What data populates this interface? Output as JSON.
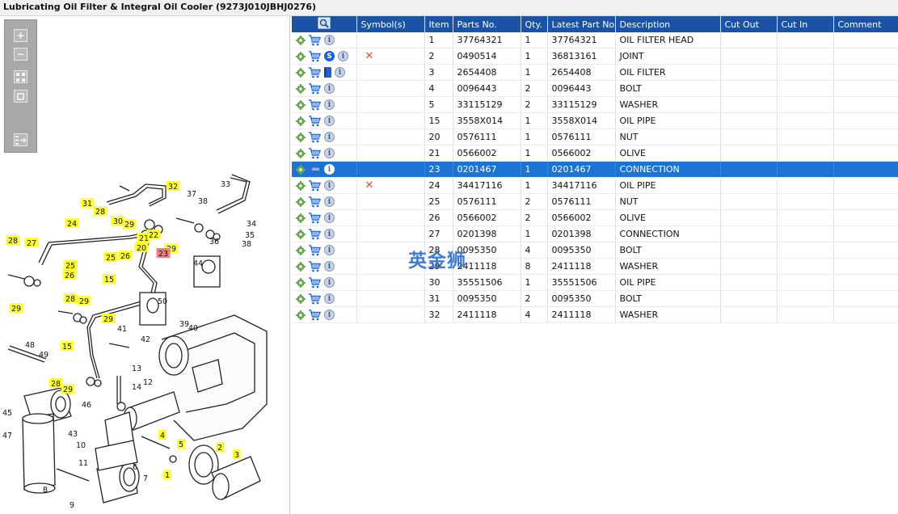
{
  "window": {
    "title": "Lubricating Oil Filter & Integral Oil Cooler (9273J010JBHJ0276)"
  },
  "watermark": "英金狮",
  "toolbar": {
    "zoom_in": "+",
    "zoom_out": "−"
  },
  "colors": {
    "header_bg": "#1a52a5",
    "selected_row": "#1b74d4",
    "callout_yellow": "#ffff33",
    "callout_highlight": "#f08080",
    "remove_mark": "#e2501e"
  },
  "columns": [
    "Symbol(s)",
    "Item",
    "Parts No.",
    "Qty.",
    "Latest Part No.",
    "Description",
    "Cut Out",
    "Cut In",
    "Comment"
  ],
  "rows": [
    {
      "item": "1",
      "part": "37764321",
      "qty": "1",
      "latest": "37764321",
      "desc": "OIL FILTER HEAD",
      "badge": "",
      "mark": ""
    },
    {
      "item": "2",
      "part": "0490514",
      "qty": "1",
      "latest": "36813161",
      "desc": "JOINT",
      "badge": "S",
      "mark": "✕"
    },
    {
      "item": "3",
      "part": "2654408",
      "qty": "1",
      "latest": "2654408",
      "desc": "OIL FILTER",
      "badge": "book",
      "mark": ""
    },
    {
      "item": "4",
      "part": "0096443",
      "qty": "2",
      "latest": "0096443",
      "desc": "BOLT",
      "badge": "",
      "mark": ""
    },
    {
      "item": "5",
      "part": "33115129",
      "qty": "2",
      "latest": "33115129",
      "desc": "WASHER",
      "badge": "",
      "mark": ""
    },
    {
      "item": "15",
      "part": "3558X014",
      "qty": "1",
      "latest": "3558X014",
      "desc": "OIL PIPE",
      "badge": "",
      "mark": ""
    },
    {
      "item": "20",
      "part": "0576111",
      "qty": "1",
      "latest": "0576111",
      "desc": "NUT",
      "badge": "",
      "mark": ""
    },
    {
      "item": "21",
      "part": "0566002",
      "qty": "1",
      "latest": "0566002",
      "desc": "OLIVE",
      "badge": "",
      "mark": ""
    },
    {
      "item": "23",
      "part": "0201467",
      "qty": "1",
      "latest": "0201467",
      "desc": "CONNECTION",
      "badge": "",
      "mark": "",
      "selected": true
    },
    {
      "item": "24",
      "part": "34417116",
      "qty": "1",
      "latest": "34417116",
      "desc": "OIL PIPE",
      "badge": "",
      "mark": "✕"
    },
    {
      "item": "25",
      "part": "0576111",
      "qty": "2",
      "latest": "0576111",
      "desc": "NUT",
      "badge": "",
      "mark": ""
    },
    {
      "item": "26",
      "part": "0566002",
      "qty": "2",
      "latest": "0566002",
      "desc": "OLIVE",
      "badge": "",
      "mark": ""
    },
    {
      "item": "27",
      "part": "0201398",
      "qty": "1",
      "latest": "0201398",
      "desc": "CONNECTION",
      "badge": "",
      "mark": ""
    },
    {
      "item": "28",
      "part": "0095350",
      "qty": "4",
      "latest": "0095350",
      "desc": "BOLT",
      "badge": "",
      "mark": ""
    },
    {
      "item": "29",
      "part": "2411118",
      "qty": "8",
      "latest": "2411118",
      "desc": "WASHER",
      "badge": "",
      "mark": ""
    },
    {
      "item": "30",
      "part": "35551506",
      "qty": "1",
      "latest": "35551506",
      "desc": "OIL PIPE",
      "badge": "",
      "mark": ""
    },
    {
      "item": "31",
      "part": "0095350",
      "qty": "2",
      "latest": "0095350",
      "desc": "BOLT",
      "badge": "",
      "mark": ""
    },
    {
      "item": "32",
      "part": "2411118",
      "qty": "4",
      "latest": "2411118",
      "desc": "WASHER",
      "badge": "",
      "mark": ""
    }
  ],
  "callouts": [
    {
      "label": "33",
      "style": "plain"
    },
    {
      "label": "37",
      "style": "plain"
    },
    {
      "label": "38",
      "style": "plain"
    },
    {
      "label": "34",
      "style": "plain"
    },
    {
      "label": "35",
      "style": "plain"
    },
    {
      "label": "36",
      "style": "plain"
    },
    {
      "label": "38",
      "style": "plain"
    },
    {
      "label": "32",
      "style": "yellow"
    },
    {
      "label": "31",
      "style": "yellow"
    },
    {
      "label": "28",
      "style": "yellow"
    },
    {
      "label": "30",
      "style": "yellow"
    },
    {
      "label": "29",
      "style": "yellow"
    },
    {
      "label": "24",
      "style": "yellow"
    },
    {
      "label": "21",
      "style": "yellow"
    },
    {
      "label": "22",
      "style": "yellow"
    },
    {
      "label": "20",
      "style": "yellow"
    },
    {
      "label": "29",
      "style": "yellow"
    },
    {
      "label": "23",
      "style": "red"
    },
    {
      "label": "25",
      "style": "yellow"
    },
    {
      "label": "26",
      "style": "yellow"
    },
    {
      "label": "28",
      "style": "yellow"
    },
    {
      "label": "27",
      "style": "yellow"
    },
    {
      "label": "25",
      "style": "yellow"
    },
    {
      "label": "26",
      "style": "yellow"
    },
    {
      "label": "29",
      "style": "yellow"
    },
    {
      "label": "15",
      "style": "yellow"
    },
    {
      "label": "44",
      "style": "plain"
    },
    {
      "label": "28",
      "style": "yellow"
    },
    {
      "label": "29",
      "style": "yellow"
    },
    {
      "label": "50",
      "style": "plain"
    },
    {
      "label": "29",
      "style": "yellow"
    },
    {
      "label": "41",
      "style": "plain"
    },
    {
      "label": "39",
      "style": "plain"
    },
    {
      "label": "40",
      "style": "plain"
    },
    {
      "label": "42",
      "style": "plain"
    },
    {
      "label": "15",
      "style": "yellow"
    },
    {
      "label": "48",
      "style": "plain"
    },
    {
      "label": "49",
      "style": "plain"
    },
    {
      "label": "13",
      "style": "plain"
    },
    {
      "label": "12",
      "style": "plain"
    },
    {
      "label": "14",
      "style": "plain"
    },
    {
      "label": "28",
      "style": "yellow"
    },
    {
      "label": "29",
      "style": "yellow"
    },
    {
      "label": "46",
      "style": "plain"
    },
    {
      "label": "45",
      "style": "plain"
    },
    {
      "label": "43",
      "style": "plain"
    },
    {
      "label": "47",
      "style": "plain"
    },
    {
      "label": "4",
      "style": "yellow"
    },
    {
      "label": "5",
      "style": "yellow"
    },
    {
      "label": "2",
      "style": "yellow"
    },
    {
      "label": "3",
      "style": "yellow"
    },
    {
      "label": "10",
      "style": "plain"
    },
    {
      "label": "11",
      "style": "plain"
    },
    {
      "label": "6",
      "style": "plain"
    },
    {
      "label": "1",
      "style": "yellow"
    },
    {
      "label": "7",
      "style": "plain"
    },
    {
      "label": "8",
      "style": "plain"
    },
    {
      "label": "9",
      "style": "plain"
    }
  ]
}
